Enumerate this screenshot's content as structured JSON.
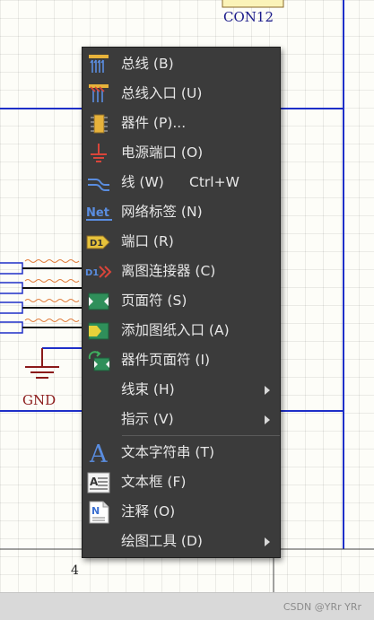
{
  "canvas": {
    "gnd_label": "GND",
    "connector_label": "CON12",
    "sheet_number": "4"
  },
  "menu": {
    "items": [
      {
        "label": "总线 (B)",
        "icon": "bus-icon"
      },
      {
        "label": "总线入口 (U)",
        "icon": "bus-entry-icon"
      },
      {
        "label": "器件 (P)...",
        "icon": "part-icon"
      },
      {
        "label": "电源端口 (O)",
        "icon": "power-port-icon"
      },
      {
        "label": "线 (W)",
        "shortcut": "Ctrl+W",
        "icon": "wire-icon"
      },
      {
        "label": "网络标签 (N)",
        "icon": "net-label-icon"
      },
      {
        "label": "端口 (R)",
        "icon": "port-icon"
      },
      {
        "label": "离图连接器 (C)",
        "icon": "off-sheet-connector-icon"
      },
      {
        "label": "页面符 (S)",
        "icon": "sheet-symbol-icon"
      },
      {
        "label": "添加图纸入口 (A)",
        "icon": "sheet-entry-icon"
      },
      {
        "label": "器件页面符 (I)",
        "icon": "device-sheet-symbol-icon"
      },
      {
        "label": "线束 (H)",
        "submenu": true
      },
      {
        "label": "指示 (V)",
        "submenu": true
      },
      {
        "label": "文本字符串 (T)",
        "icon": "text-string-icon"
      },
      {
        "label": "文本框 (F)",
        "icon": "text-frame-icon"
      },
      {
        "label": "注释 (O)",
        "icon": "note-icon"
      },
      {
        "label": "绘图工具 (D)",
        "submenu": true
      }
    ]
  },
  "statusbar": {
    "watermark": "CSDN @YRr YRr"
  },
  "colors": {
    "wire": "#1e2fc8",
    "power": "#8b1a1a",
    "menu_bg": "#3b3b3b",
    "menu_text": "#e6e6e6"
  }
}
